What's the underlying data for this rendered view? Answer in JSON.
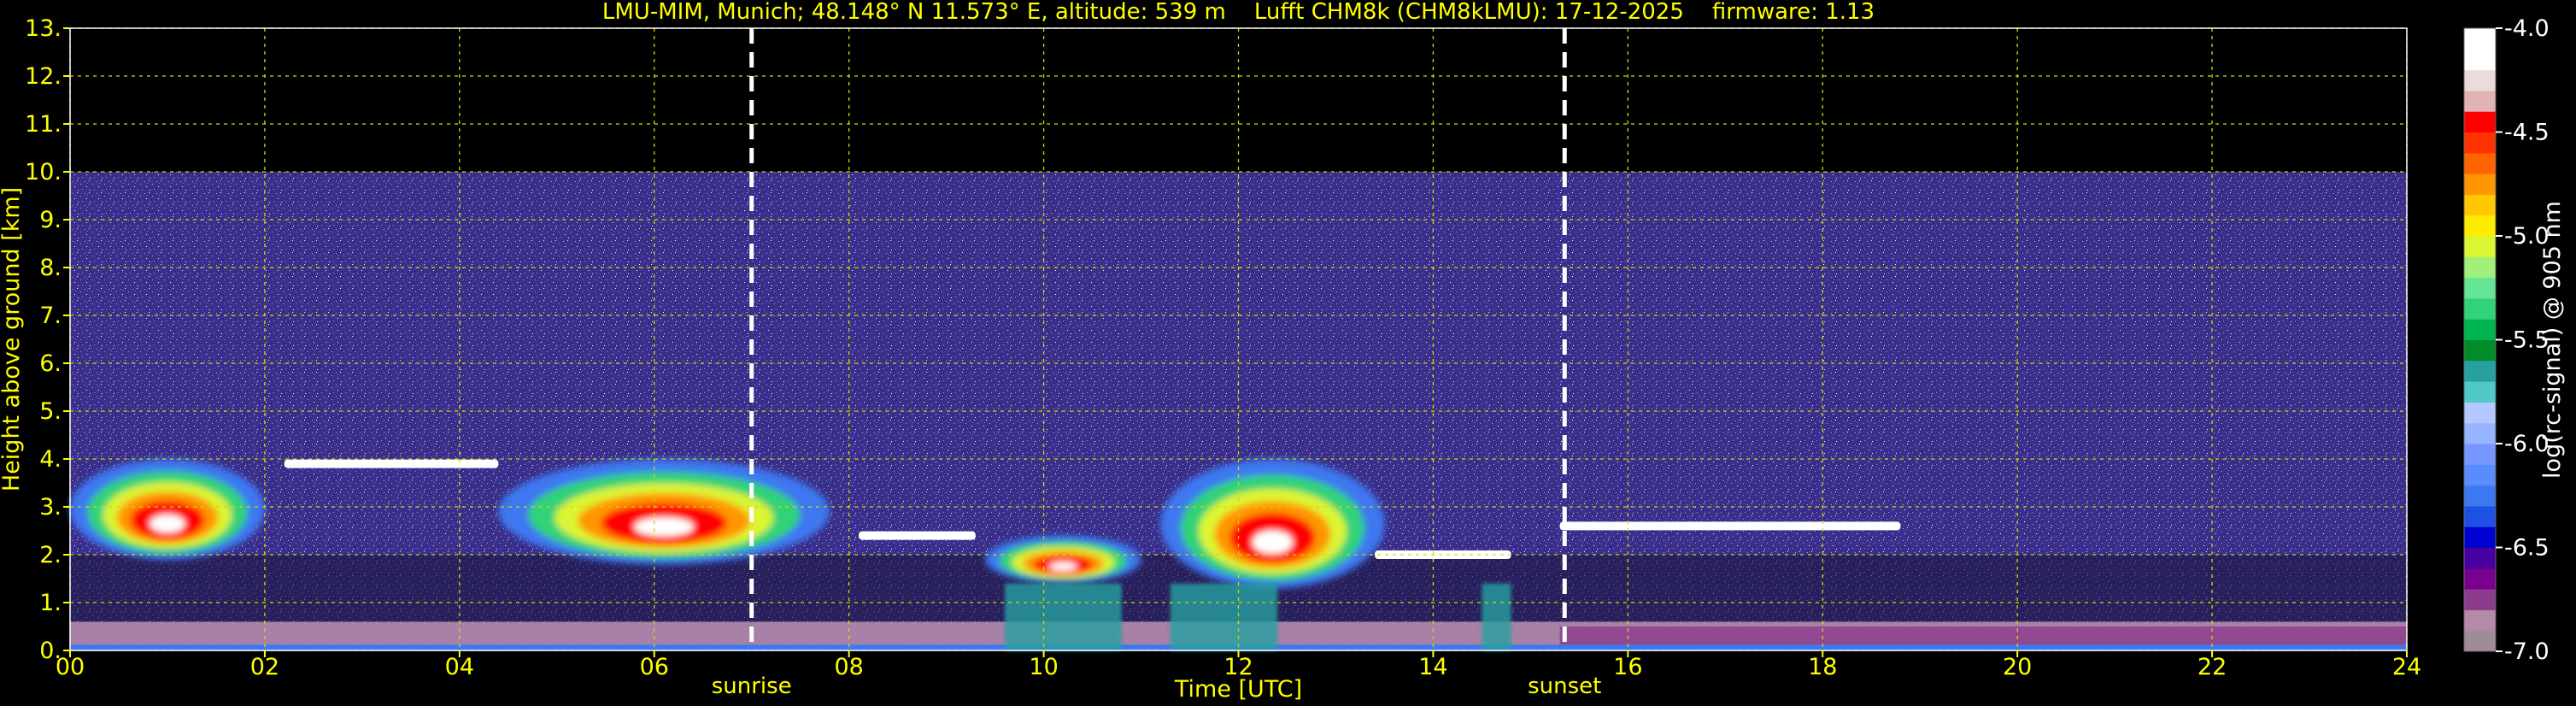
{
  "chart_data": {
    "type": "heatmap",
    "title": "LMU-MIM, Munich; 48.148° N 11.573° E, altitude: 539 m    Lufft CHM8k (CHM8kLMU): 17-12-2025    firmware: 1.13",
    "xlabel": "Time [UTC]",
    "ylabel": "Height above ground [km]",
    "xlim": [
      0,
      24
    ],
    "ylim": [
      0,
      13
    ],
    "x_ticks": [
      "00",
      "02",
      "04",
      "06",
      "08",
      "10",
      "12",
      "14",
      "16",
      "18",
      "20",
      "22",
      "24"
    ],
    "y_ticks": [
      "0.",
      "1.",
      "2.",
      "3.",
      "4.",
      "5.",
      "6.",
      "7.",
      "8.",
      "9.",
      "10.",
      "11.",
      "12.",
      "13."
    ],
    "grid": true,
    "data_top_km": 10,
    "events": [
      {
        "label": "sunrise",
        "time_h": 7.0
      },
      {
        "label": "sunset",
        "time_h": 15.35
      }
    ],
    "colorbar": {
      "label": "log(rc-signal) @ 905 nm",
      "range": [
        -7.0,
        -4.0
      ],
      "ticks": [
        "-4.0",
        "-4.5",
        "-5.0",
        "-5.5",
        "-6.0",
        "-6.5",
        "-7.0"
      ],
      "colors": [
        "#a08c96",
        "#b48aa8",
        "#8c3c8c",
        "#7a0090",
        "#4800a0",
        "#0000d0",
        "#1e50e6",
        "#3c78f0",
        "#5a8cff",
        "#7896ff",
        "#96b4ff",
        "#b4c8ff",
        "#50c8c8",
        "#28a0a0",
        "#008c28",
        "#00b450",
        "#32d278",
        "#64e696",
        "#a0f07a",
        "#dcf532",
        "#ffeb00",
        "#ffc800",
        "#ff9600",
        "#ff6400",
        "#ff3200",
        "#ff0000",
        "#e0b4b4",
        "#ebdcdc",
        "#ffffff",
        "#ffffff"
      ]
    },
    "features": {
      "cloud_layers": [
        {
          "start_h": 0.0,
          "end_h": 2.0,
          "base_km": 1.9,
          "top_km": 4.0,
          "intensity": "high"
        },
        {
          "start_h": 4.4,
          "end_h": 7.8,
          "base_km": 1.8,
          "top_km": 4.0,
          "intensity": "high"
        },
        {
          "start_h": 9.4,
          "end_h": 11.0,
          "base_km": 1.4,
          "top_km": 2.4,
          "intensity": "high"
        },
        {
          "start_h": 11.2,
          "end_h": 13.5,
          "base_km": 1.3,
          "top_km": 4.0,
          "intensity": "high"
        }
      ],
      "thin_layers": [
        {
          "start_h": 2.2,
          "end_h": 4.4,
          "height_km": 3.9
        },
        {
          "start_h": 8.1,
          "end_h": 9.3,
          "height_km": 2.4
        },
        {
          "start_h": 13.4,
          "end_h": 14.8,
          "height_km": 2.0
        },
        {
          "start_h": 15.3,
          "end_h": 18.8,
          "height_km": 2.6
        }
      ],
      "boundary_layer_top_km": 0.6
    }
  }
}
